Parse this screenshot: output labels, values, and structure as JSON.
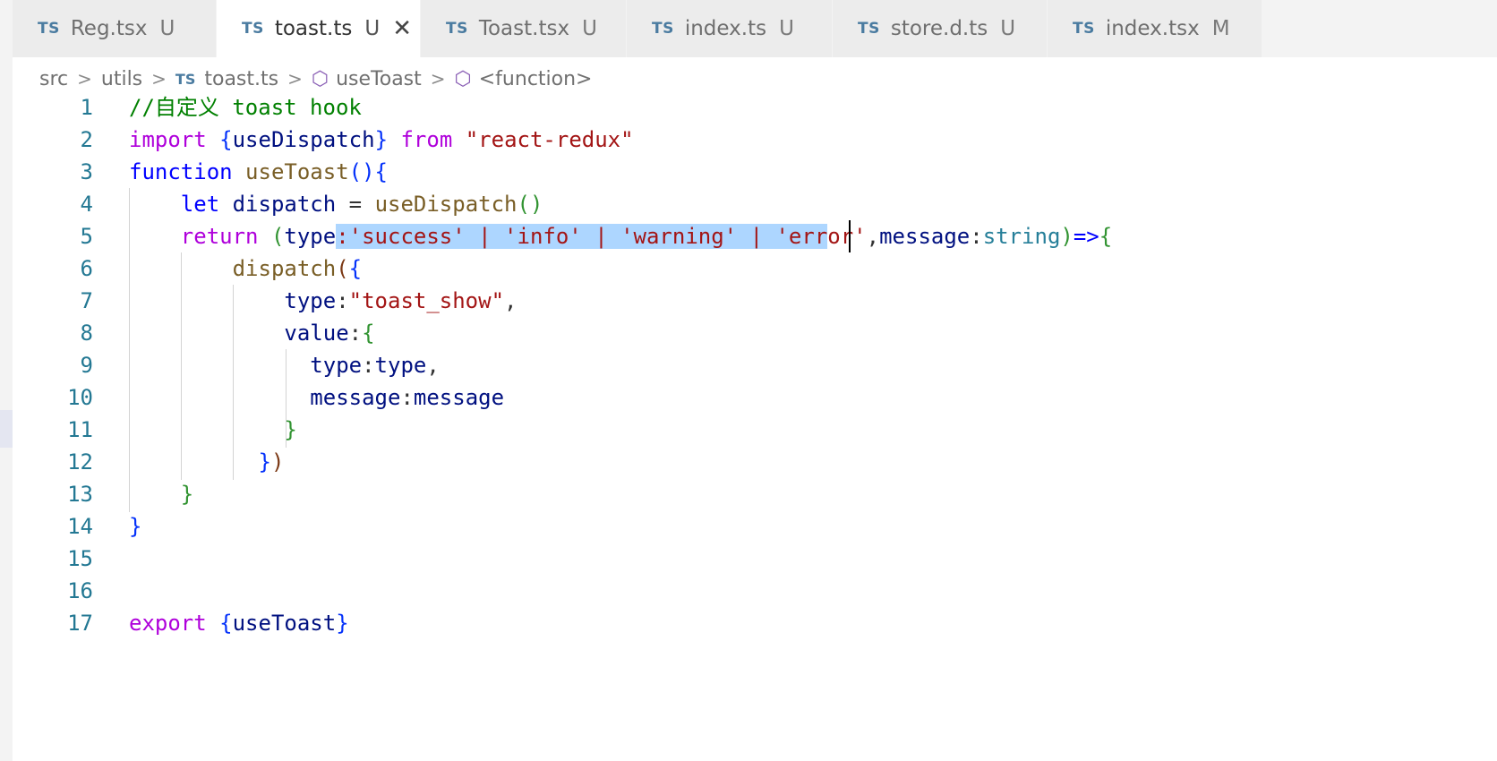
{
  "tabs": [
    {
      "icon": "TS",
      "name": "Reg.tsx",
      "status": "U",
      "active": false
    },
    {
      "icon": "TS",
      "name": "toast.ts",
      "status": "U",
      "active": true,
      "close": "✕"
    },
    {
      "icon": "TS",
      "name": "Toast.tsx",
      "status": "U",
      "active": false
    },
    {
      "icon": "TS",
      "name": "index.ts",
      "status": "U",
      "active": false
    },
    {
      "icon": "TS",
      "name": "store.d.ts",
      "status": "U",
      "active": false
    },
    {
      "icon": "TS",
      "name": "index.tsx",
      "status": "M",
      "active": false
    }
  ],
  "breadcrumb": {
    "items": [
      "src",
      "utils",
      "toast.ts",
      "useToast",
      "<function>"
    ],
    "file_icon": "TS",
    "separator": ">"
  },
  "editor": {
    "line_numbers": [
      "1",
      "2",
      "3",
      "4",
      "5",
      "6",
      "7",
      "8",
      "9",
      "10",
      "11",
      "12",
      "13",
      "14",
      "15",
      "16",
      "17"
    ],
    "lines": {
      "l1": {
        "comment": "//自定义 toast hook"
      },
      "l2": {
        "kw": "import",
        "open": "{",
        "name": "useDispatch",
        "close": "}",
        "from": "from",
        "str": "\"react-redux\""
      },
      "l3": {
        "kw": "function",
        "name": "useToast",
        "parens": "()",
        "open": "{"
      },
      "l4": {
        "kw": "let",
        "var": "dispatch",
        "eq": " = ",
        "fn": "useDispatch",
        "parens": "()"
      },
      "l5": {
        "kw": "return",
        "paren_open": "(",
        "param": "type",
        "sel_text": ":'success' | 'info' | 'warning' | 'err",
        "rest_str": "or'",
        "comma": ",",
        "param2": "message",
        "colon": ":",
        "type2": "string",
        "paren_close": ")",
        "arrow": "=>",
        "open": "{"
      },
      "l6": {
        "fn": "dispatch",
        "paren_open": "(",
        "open": "{"
      },
      "l7": {
        "prop": "type",
        "colon": ":",
        "str": "\"toast_show\"",
        "comma": ","
      },
      "l8": {
        "prop": "value",
        "colon": ":",
        "open": "{"
      },
      "l9": {
        "prop": "type",
        "colon": ":",
        "val": "type",
        "comma": ","
      },
      "l10": {
        "prop": "message",
        "colon": ":",
        "val": "message"
      },
      "l11": {
        "close": "}"
      },
      "l12": {
        "close": "}",
        "paren_close": ")"
      },
      "l13": {
        "close": "}"
      },
      "l14": {
        "close": "}"
      },
      "l17": {
        "kw": "export",
        "open": "{",
        "name": "useToast",
        "close": "}"
      }
    }
  },
  "colors": {
    "keyword": "#0000ff",
    "control_keyword": "#af00db",
    "string": "#a31515",
    "comment": "#008000",
    "function": "#795e26",
    "variable": "#001080",
    "type": "#267f99",
    "selection": "#add6ff",
    "line_number": "#237893"
  }
}
